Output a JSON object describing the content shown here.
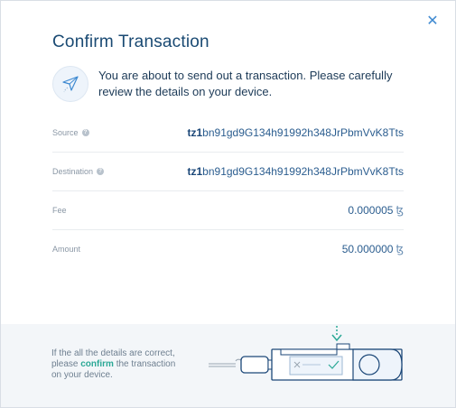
{
  "dialog": {
    "title": "Confirm Transaction",
    "close_icon": "close-icon",
    "intro_icon": "paper-plane-icon",
    "intro_text": "You are about to send out a transaction. Please carefully review the details on your device."
  },
  "details": {
    "source": {
      "label": "Source",
      "help_icon": "help-icon",
      "address_prefix": "tz1",
      "address_rest": "bn91gd9G134h91992h348JrPbmVvK8Tts"
    },
    "destination": {
      "label": "Destination",
      "help_icon": "help-icon",
      "address_prefix": "tz1",
      "address_rest": "bn91gd9G134h91992h348JrPbmVvK8Tts"
    },
    "fee": {
      "label": "Fee",
      "value": "0.000005",
      "currency": "ꜩ"
    },
    "amount": {
      "label": "Amount",
      "value": "50.000000",
      "currency": "ꜩ"
    }
  },
  "footer": {
    "text_before": "If the all the details are correct, please ",
    "text_bold": "confirm",
    "text_after": " the transaction on your device.",
    "device_icon": "ledger-device-icon"
  },
  "colors": {
    "title": "#1a4a73",
    "accent": "#3f8ad1",
    "confirm": "#2ba896",
    "footer_bg": "#f3f6f9"
  }
}
